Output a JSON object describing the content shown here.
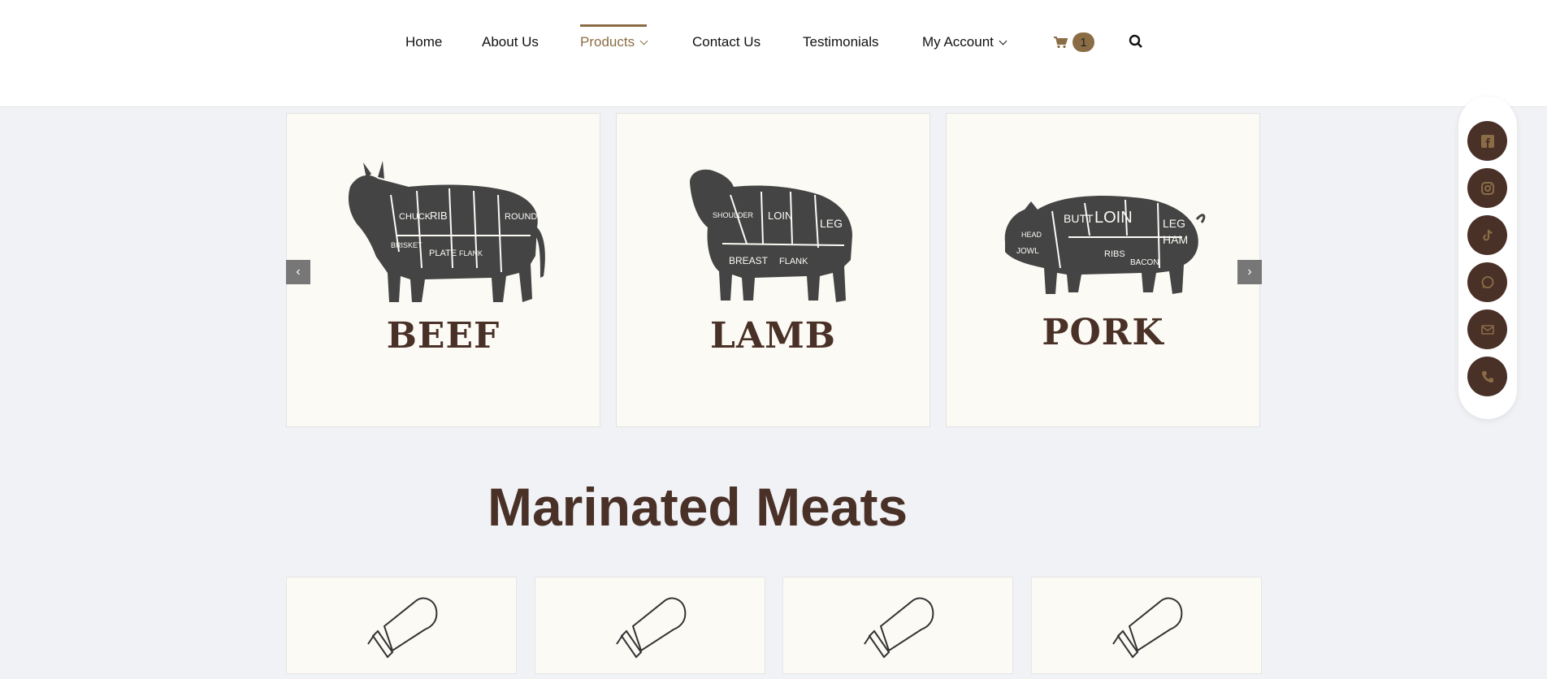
{
  "nav": {
    "home": "Home",
    "about": "About Us",
    "products": "Products",
    "contact": "Contact Us",
    "testimonials": "Testimonials",
    "account": "My Account",
    "cart_count": "1"
  },
  "carousel": {
    "items": [
      {
        "label": "BEEF",
        "icon": "cow-cuts-icon"
      },
      {
        "label": "LAMB",
        "icon": "sheep-cuts-icon"
      },
      {
        "label": "PORK",
        "icon": "pig-cuts-icon"
      }
    ],
    "prev_glyph": "‹",
    "next_glyph": "›"
  },
  "section": {
    "title": "Marinated Meats"
  },
  "products": [
    {
      "icon": "salt-shaker-icon"
    },
    {
      "icon": "salt-shaker-icon"
    },
    {
      "icon": "salt-shaker-icon"
    },
    {
      "icon": "salt-shaker-icon"
    }
  ],
  "social": [
    "facebook-icon",
    "instagram-icon",
    "tiktok-icon",
    "whatsapp-icon",
    "email-icon",
    "phone-icon"
  ],
  "colors": {
    "accent": "#8a6d45",
    "brand_dark": "#4a3128",
    "page_bg": "#f0f2f5",
    "card_bg": "#fcfaf5"
  }
}
